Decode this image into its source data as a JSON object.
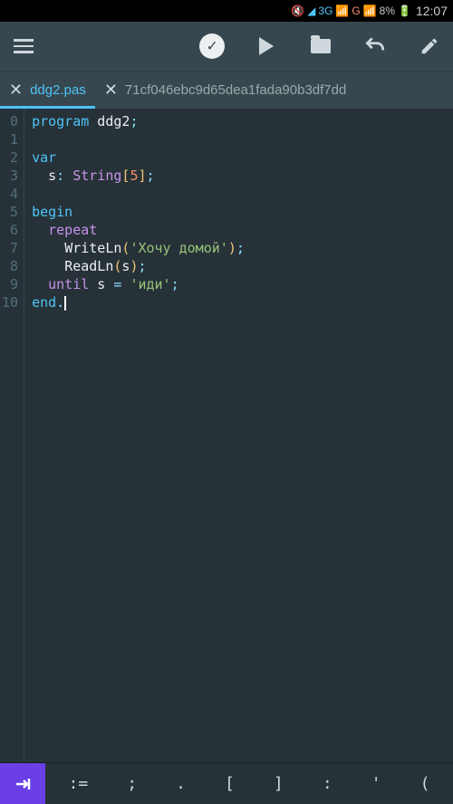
{
  "status": {
    "network1": "3G",
    "network2": "G",
    "battery": "8%",
    "time": "12:07"
  },
  "tabs": [
    {
      "label": "ddg2.pas",
      "active": true
    },
    {
      "label": "71cf046ebc9d65dea1fada90b3df7dd",
      "active": false
    }
  ],
  "code": {
    "lines": [
      {
        "n": "0",
        "tokens": [
          [
            "kw-blue",
            "program"
          ],
          [
            "ident",
            " ddg2"
          ],
          [
            "punct",
            ";"
          ]
        ]
      },
      {
        "n": "1",
        "tokens": []
      },
      {
        "n": "2",
        "tokens": [
          [
            "kw-blue",
            "var"
          ]
        ]
      },
      {
        "n": "3",
        "tokens": [
          [
            "ident",
            "  s"
          ],
          [
            "punct",
            ": "
          ],
          [
            "kw-purple",
            "String"
          ],
          [
            "paren-gold",
            "["
          ],
          [
            "num-orange",
            "5"
          ],
          [
            "paren-gold",
            "]"
          ],
          [
            "punct",
            ";"
          ]
        ]
      },
      {
        "n": "4",
        "tokens": []
      },
      {
        "n": "5",
        "tokens": [
          [
            "kw-blue",
            "begin"
          ]
        ]
      },
      {
        "n": "6",
        "tokens": [
          [
            "ident",
            "  "
          ],
          [
            "kw-purple",
            "repeat"
          ]
        ]
      },
      {
        "n": "7",
        "tokens": [
          [
            "ident",
            "    "
          ],
          [
            "fn-white",
            "WriteLn"
          ],
          [
            "paren-gold",
            "("
          ],
          [
            "str-green",
            "'Хочу домой'"
          ],
          [
            "paren-gold",
            ")"
          ],
          [
            "punct",
            ";"
          ]
        ]
      },
      {
        "n": "8",
        "tokens": [
          [
            "ident",
            "    "
          ],
          [
            "fn-white",
            "ReadLn"
          ],
          [
            "paren-gold",
            "("
          ],
          [
            "ident",
            "s"
          ],
          [
            "paren-gold",
            ")"
          ],
          [
            "punct",
            ";"
          ]
        ]
      },
      {
        "n": "9",
        "tokens": [
          [
            "ident",
            "  "
          ],
          [
            "kw-purple",
            "until"
          ],
          [
            "ident",
            " s "
          ],
          [
            "punct",
            "= "
          ],
          [
            "str-green",
            "'иди'"
          ],
          [
            "punct",
            ";"
          ]
        ]
      },
      {
        "n": "10",
        "tokens": [
          [
            "kw-blue",
            "end"
          ],
          [
            "punct",
            "."
          ],
          [
            "cursor",
            ""
          ]
        ]
      }
    ]
  },
  "symbols": [
    ":=",
    ";",
    ".",
    "[",
    "]",
    ":",
    "'",
    "("
  ]
}
